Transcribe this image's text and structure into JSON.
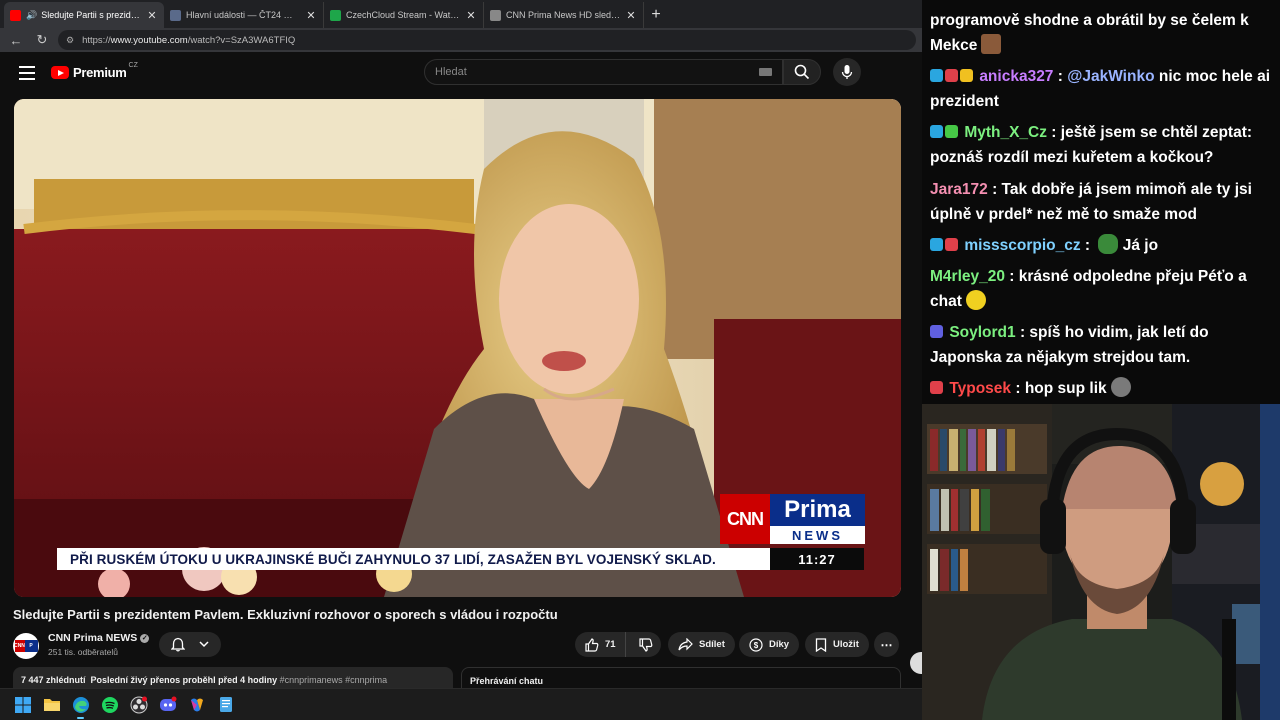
{
  "browser": {
    "tabs": [
      {
        "title": "Sledujte Partii s prezidentem",
        "favicon_color": "#ff0000",
        "active": true
      },
      {
        "title": "Hlavní události — ČT24 — Česká",
        "favicon_color": "#5a6a8a",
        "active": false
      },
      {
        "title": "CzechCloud Stream - Watch Live o",
        "favicon_color": "#1ea64a",
        "active": false
      },
      {
        "title": "CNN Prima News HD sledujte onli",
        "favicon_color": "#888888",
        "active": false
      }
    ],
    "url_prefix": "https://",
    "url_host": "www.youtube.com",
    "url_path": "/watch?v=SzA3WA6TFIQ"
  },
  "youtube": {
    "logo_text": "Premium",
    "logo_country": "CZ",
    "search_placeholder": "Hledat"
  },
  "video": {
    "ticker_headline": "PŘI RUSKÉM ÚTOKU U UKRAJINSKÉ BUČI ZAHYNULO 37 LIDÍ, ZASAŽEN BYL VOJENSKÝ SKLAD.",
    "ticker_time": "11:27",
    "cnn_logo": "CNN",
    "prima_logo_top": "Prima",
    "prima_logo_bottom": "NEWS",
    "title": "Sledujte Partii s prezidentem Pavlem. Exkluzivní rozhovor o sporech s vládou i rozpočtu",
    "channel_name": "CNN Prima NEWS",
    "subscribers": "251 tis. odběratelů",
    "likes": "71",
    "share_label": "Sdílet",
    "thanks_label": "Díky",
    "save_label": "Uložit",
    "description_views": "7 447 zhlédnutí",
    "description_status": "Poslední živý přenos proběhl před 4 hodiny",
    "description_tags": "#cnnprimanews #cnnprima",
    "chat_replay_label": "Přehrávání chatu"
  },
  "chat": {
    "messages": [
      {
        "user": "",
        "user_color": "#ffffff",
        "text": "programově shodne a obrátil by se čelem k Mekce",
        "badges": [],
        "emote": "#8a5a3a"
      },
      {
        "user": "anicka327",
        "user_color": "#c77dff",
        "text": "@JakWinko nic moc hele ai prezident",
        "mention": "@JakWinko",
        "badges": [
          "#2aa6e0",
          "#e0404a",
          "#f0c020"
        ],
        "emote": ""
      },
      {
        "user": "Myth_X_Cz",
        "user_color": "#7cf080",
        "text": "ještě jsem se chtěl zeptat: poznáš rozdíl mezi kuřetem a kočkou?",
        "badges": [
          "#2aa6e0",
          "#46c846"
        ],
        "emote": ""
      },
      {
        "user": "Jara172",
        "user_color": "#f48fb1",
        "text": "Tak dobře já jsem mimoň ale ty jsi úplně v prdel* než mě to smaže mod",
        "badges": [],
        "emote": ""
      },
      {
        "user": "missscorpio_cz",
        "user_color": "#7fd1ff",
        "text": "Já jo",
        "badges": [
          "#2aa6e0",
          "#e0404a"
        ],
        "emote": "#3a8a3a"
      },
      {
        "user": "M4rley_20",
        "user_color": "#7cf080",
        "text": "krásné odpoledne přeju Péťo a chat",
        "badges": [],
        "emote": "#f0d020"
      },
      {
        "user": "Soylord1",
        "user_color": "#7cf080",
        "text": "spíš ho vidim, jak letí do Japonska za nějakym strejdou tam.",
        "badges": [
          "#6060e0"
        ],
        "emote": ""
      },
      {
        "user": "Typosek",
        "user_color": "#ff4a4a",
        "text": "hop sup lik",
        "badges": [
          "#e0404a"
        ],
        "emote": "#7a7a7a"
      }
    ]
  },
  "taskbar": {
    "apps": [
      "windows-start",
      "file-explorer",
      "edge-browser",
      "spotify",
      "obs-studio",
      "discord",
      "copilot",
      "notepad"
    ]
  }
}
